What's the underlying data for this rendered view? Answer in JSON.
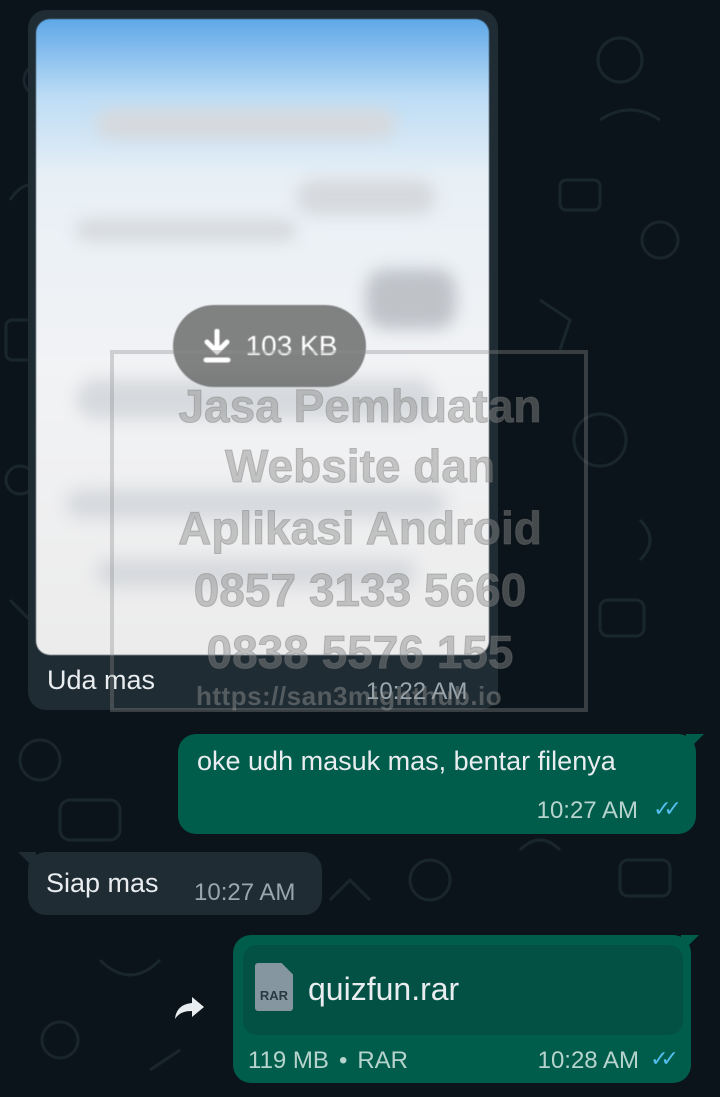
{
  "messages": {
    "image_msg": {
      "download_size": "103 KB",
      "caption": "Uda mas",
      "time": "10:22 AM"
    },
    "reply_1": {
      "text": "oke udh masuk mas, bentar filenya",
      "time": "10:27 AM",
      "status_icon": "double-check-read-icon"
    },
    "incoming_2": {
      "text": "Siap mas",
      "time": "10:27 AM"
    },
    "file_msg": {
      "file_name": "quizfun.rar",
      "file_icon_label": "RAR",
      "file_size": "119 MB",
      "separator": "•",
      "file_type": "RAR",
      "time": "10:28 AM",
      "status_icon": "double-check-read-icon"
    }
  },
  "watermark": {
    "lines": [
      "Jasa Pembuatan",
      "Website dan",
      "Aplikasi Android",
      "0857 3133 5660",
      "0838 5576 155"
    ],
    "url": "https://san3mighthub.io"
  },
  "colors": {
    "background": "#0b141a",
    "incoming_bubble": "#1f2c34",
    "outgoing_bubble": "#005c4b",
    "read_ticks": "#53bdeb"
  }
}
